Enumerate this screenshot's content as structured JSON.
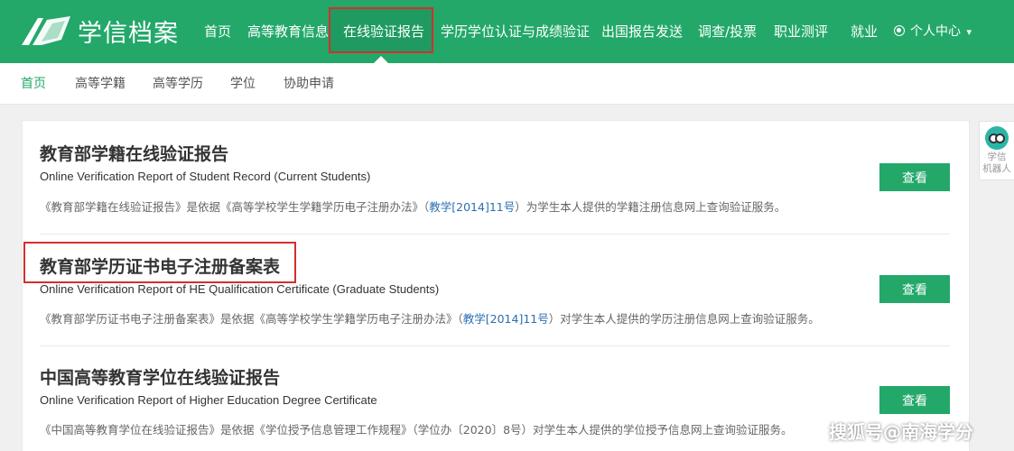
{
  "header": {
    "logo_text": "学信档案",
    "nav": [
      {
        "label": "首页"
      },
      {
        "label": "高等教育信息"
      },
      {
        "label": "在线验证报告",
        "active": true
      },
      {
        "label": "学历学位认证与成绩验证"
      },
      {
        "label": "出国报告发送"
      },
      {
        "label": "调查/投票"
      },
      {
        "label": "职业测评"
      },
      {
        "label": "就业"
      },
      {
        "label": "个人中心"
      }
    ],
    "user_caret": "▾"
  },
  "subnav": {
    "items": [
      {
        "label": "首页",
        "active": true
      },
      {
        "label": "高等学籍"
      },
      {
        "label": "高等学历"
      },
      {
        "label": "学位"
      },
      {
        "label": "协助申请"
      }
    ]
  },
  "reports": [
    {
      "title": "教育部学籍在线验证报告",
      "subtitle": "Online Verification Report of Student Record (Current Students)",
      "desc_before": "《教育部学籍在线验证报告》是依据《高等学校学生学籍学历电子注册办法》（",
      "desc_link": "教学[2014]11号",
      "desc_after": "）为学生本人提供的学籍注册信息网上查询验证服务。",
      "button": "查看"
    },
    {
      "title": "教育部学历证书电子注册备案表",
      "subtitle": "Online Verification Report of HE Qualification Certificate (Graduate Students)",
      "desc_before": "《教育部学历证书电子注册备案表》是依据《高等学校学生学籍学历电子注册办法》（",
      "desc_link": "教学[2014]11号",
      "desc_after": "）对学生本人提供的学历注册信息网上查询验证服务。",
      "button": "查看"
    },
    {
      "title": "中国高等教育学位在线验证报告",
      "subtitle": "Online Verification Report of Higher Education Degree Certificate",
      "desc_before": "《中国高等教育学位在线验证报告》是依据《学位授予信息管理工作规程》（学位办〔2020〕8号）对学生本人提供的学位授予信息网上查询验证服务。",
      "desc_link": "",
      "desc_after": "",
      "button": "查看"
    }
  ],
  "robot": {
    "label_line1": "学信",
    "label_line2": "机器人"
  },
  "watermark": "搜狐号@南海学分",
  "colors": {
    "brand_green": "#23a86a",
    "highlight_red": "#d32f2f",
    "link_blue": "#2a6fb5"
  }
}
